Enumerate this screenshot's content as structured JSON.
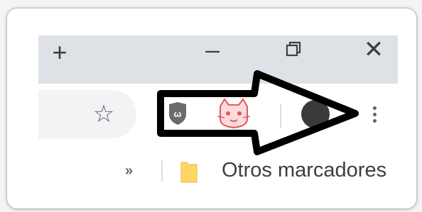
{
  "window_controls": {
    "new_tab_icon": "plus-icon",
    "new_tab_glyph": "+",
    "minimize_icon": "minimize-icon",
    "restore_icon": "restore-icon",
    "close_icon": "close-icon",
    "close_glyph": "✕"
  },
  "toolbar": {
    "bookmark_star_icon": "star-outline-icon",
    "bookmark_star_glyph": "☆",
    "extensions": [
      "ublock-origin-icon",
      "cat-extension-icon"
    ],
    "profile_icon": "profile-avatar-icon",
    "menu_icon": "three-dots-vertical-icon"
  },
  "bookmarks_bar": {
    "overflow_glyph": "»",
    "folder_icon": "folder-icon",
    "folder_label": "Otros marcadores"
  },
  "annotation": {
    "arrow_icon": "pointing-arrow-icon",
    "arrow_color": "#000000"
  },
  "colors": {
    "tabstrip": "#dee1e6",
    "omnibox": "#f1f3f4",
    "icon": "#5f6368",
    "folder": "#fdd663",
    "ublock": "#6b6b6b",
    "cat": "#e2585c"
  }
}
